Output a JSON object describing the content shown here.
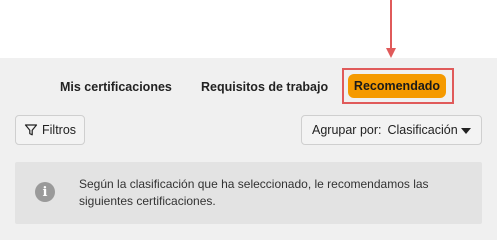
{
  "tabs": {
    "mis_certificaciones": "Mis certificaciones",
    "requisitos_trabajo": "Requisitos de trabajo",
    "recomendado": "Recomendado"
  },
  "toolbar": {
    "filter_label": "Filtros",
    "group_by_label": "Agrupar por:",
    "group_by_value": "Clasificación"
  },
  "info": {
    "icon_glyph": "i",
    "message": "Según la clasificación que ha seleccionado, le recomendamos las siguientes certificaciones."
  },
  "colors": {
    "active_tab": "#f59a00",
    "annotation": "#e05a5a",
    "panel_bg": "#f0f0f0",
    "info_bg": "#e3e3e3"
  }
}
